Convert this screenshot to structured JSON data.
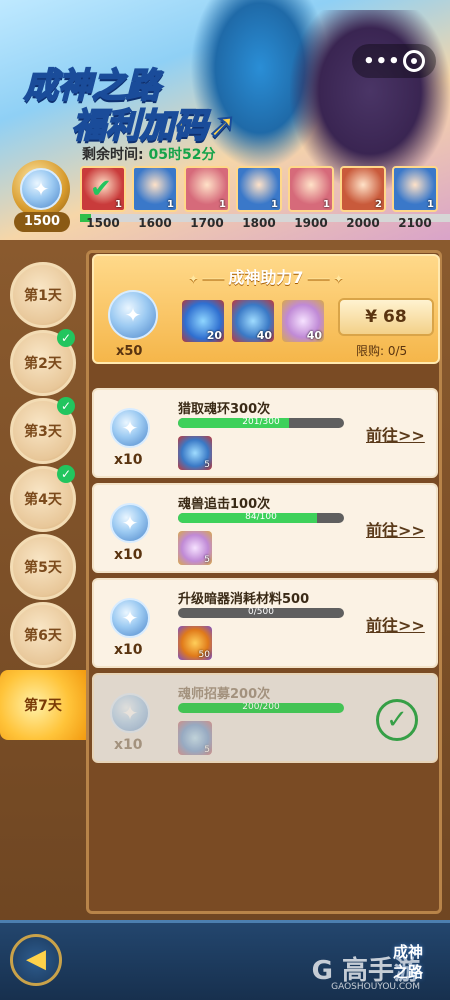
{
  "banner": {
    "title_line1": "成神之路",
    "title_line2_part1": "福利",
    "title_line2_part2": "加码",
    "timer_label": "剩余时间:",
    "timer_value": "05时52分"
  },
  "milestones": {
    "current_points": "1500",
    "progress_fraction": 0.03,
    "items": [
      {
        "points": "1500",
        "count": "1",
        "claimed": true
      },
      {
        "points": "1600",
        "count": "1",
        "claimed": false
      },
      {
        "points": "1700",
        "count": "1",
        "claimed": false
      },
      {
        "points": "1800",
        "count": "1",
        "claimed": false
      },
      {
        "points": "1900",
        "count": "1",
        "claimed": false
      },
      {
        "points": "2000",
        "count": "2",
        "claimed": false
      },
      {
        "points": "2100",
        "count": "1",
        "claimed": false
      }
    ]
  },
  "days": [
    {
      "label": "第1天",
      "completed": false,
      "active": false
    },
    {
      "label": "第2天",
      "completed": true,
      "active": false
    },
    {
      "label": "第3天",
      "completed": true,
      "active": false
    },
    {
      "label": "第4天",
      "completed": true,
      "active": false
    },
    {
      "label": "第5天",
      "completed": false,
      "active": false
    },
    {
      "label": "第6天",
      "completed": false,
      "active": false
    },
    {
      "label": "第7天",
      "completed": false,
      "active": true
    }
  ],
  "pack": {
    "title": "成神助力7",
    "coin_count": "x50",
    "items": [
      {
        "icon": "blue-crystal-icon",
        "count": "20"
      },
      {
        "icon": "soul-ring-icon",
        "count": "40"
      },
      {
        "icon": "potion-icon",
        "count": "40"
      }
    ],
    "price": "¥ 68",
    "limit_label": "限购:",
    "limit_value": "0/5"
  },
  "tasks": [
    {
      "title": "猎取魂环300次",
      "progress_text": "201/300",
      "progress": 0.67,
      "coin_count": "x10",
      "item_count": "5",
      "item_icon": "soul-ring-icon",
      "action": "前往>>",
      "done": false
    },
    {
      "title": "魂兽追击100次",
      "progress_text": "84/100",
      "progress": 0.84,
      "coin_count": "x10",
      "item_count": "5",
      "item_icon": "potion-icon",
      "action": "前往>>",
      "done": false
    },
    {
      "title": "升级暗器消耗材料500",
      "progress_text": "0/500",
      "progress": 0.0,
      "coin_count": "x10",
      "item_count": "50",
      "item_icon": "orange-gem-icon",
      "action": "前往>>",
      "done": false
    },
    {
      "title": "魂师招募200次",
      "progress_text": "200/200",
      "progress": 1.0,
      "coin_count": "x10",
      "item_count": "5",
      "item_icon": "soul-ring-icon",
      "action": "",
      "done": true
    }
  ],
  "bottom": {
    "corner_label_1": "成神",
    "corner_label_2": "之路",
    "watermark": "G 高手游",
    "watermark_url": "GAOSHOUYOU.COM"
  },
  "colors": {
    "accent": "#f5b64a",
    "progress_green": "#3ed15a",
    "panel_brown": "#7a4b24"
  }
}
